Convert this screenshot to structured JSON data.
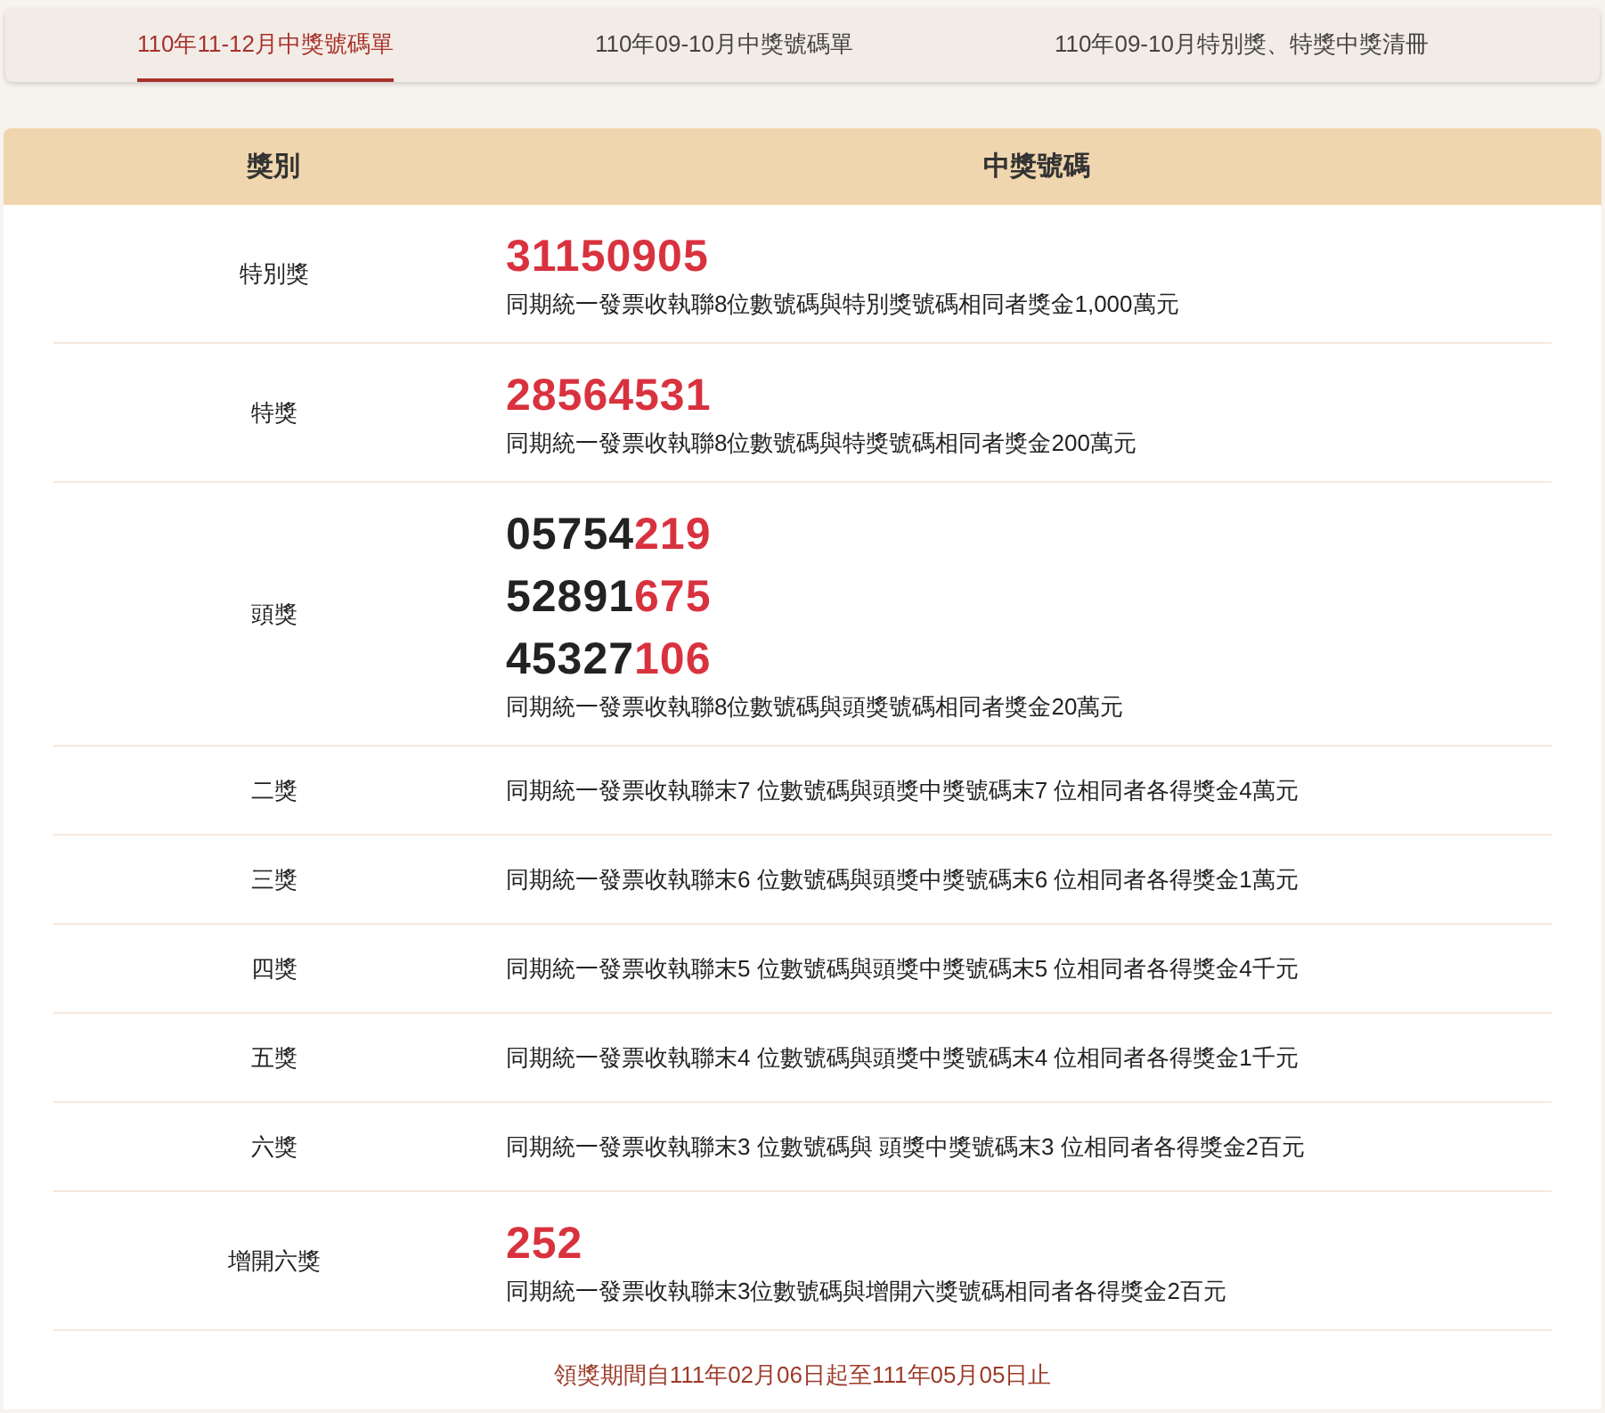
{
  "tabs": [
    {
      "label": "110年11-12月中獎號碼單",
      "selected": true
    },
    {
      "label": "110年09-10月中獎號碼單",
      "selected": false
    },
    {
      "label": "110年09-10月特別獎、特獎中獎清冊",
      "selected": false
    }
  ],
  "table": {
    "columns": [
      "獎別",
      "中獎號碼"
    ],
    "rows": [
      {
        "prize": "特別獎",
        "numbers": [
          {
            "highlight": "31150905"
          }
        ],
        "note": "同期統一發票收執聯8位數號碼與特別獎號碼相同者獎金1,000萬元"
      },
      {
        "prize": "特獎",
        "numbers": [
          {
            "highlight": "28564531"
          }
        ],
        "note": "同期統一發票收執聯8位數號碼與特獎號碼相同者獎金200萬元"
      },
      {
        "prize": "頭獎",
        "numbers": [
          {
            "plain": "05754",
            "highlight": "219"
          },
          {
            "plain": "52891",
            "highlight": "675"
          },
          {
            "plain": "45327",
            "highlight": "106"
          }
        ],
        "note": "同期統一發票收執聯8位數號碼與頭獎號碼相同者獎金20萬元"
      },
      {
        "prize": "二獎",
        "note": "同期統一發票收執聯末7 位數號碼與頭獎中獎號碼末7 位相同者各得獎金4萬元"
      },
      {
        "prize": "三獎",
        "note": "同期統一發票收執聯末6 位數號碼與頭獎中獎號碼末6 位相同者各得獎金1萬元"
      },
      {
        "prize": "四獎",
        "note": "同期統一發票收執聯末5 位數號碼與頭獎中獎號碼末5 位相同者各得獎金4千元"
      },
      {
        "prize": "五獎",
        "note": "同期統一發票收執聯末4 位數號碼與頭獎中獎號碼末4 位相同者各得獎金1千元"
      },
      {
        "prize": "六獎",
        "note": "同期統一發票收執聯末3 位數號碼與 頭獎中獎號碼末3 位相同者各得獎金2百元"
      },
      {
        "prize": "增開六獎",
        "numbers": [
          {
            "highlight": "252"
          }
        ],
        "note": "同期統一發票收執聯末3位數號碼與增開六獎號碼相同者各得獎金2百元"
      }
    ],
    "footer": "領獎期間自111年02月06日起至111年05月05日止"
  }
}
